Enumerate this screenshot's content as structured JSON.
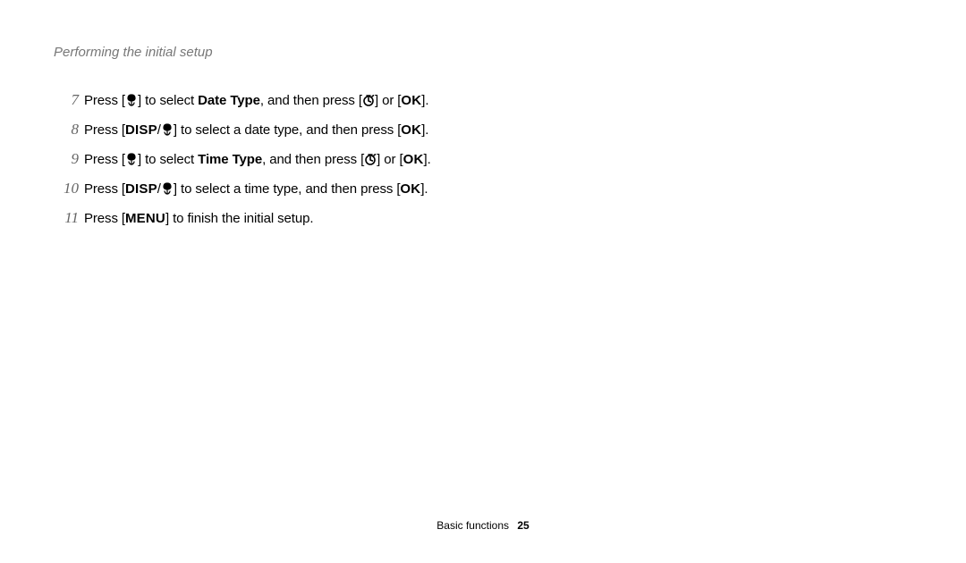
{
  "header_title": "Performing the initial setup",
  "icons": {
    "macro": "macro-icon",
    "timer": "timer-icon",
    "ok": "OK",
    "disp": "DISP",
    "menu": "MENU"
  },
  "steps": [
    {
      "num": "7",
      "pre": "Press [",
      "mid1": "] to select ",
      "bold": "Date Type",
      "mid2": ", and then press [",
      "mid3": "] or [",
      "tail": "].",
      "btn_left": "macro",
      "btn_mid": "timer",
      "btn_right": "ok",
      "disp_slash": false
    },
    {
      "num": "8",
      "pre": "Press [",
      "mid1": "] to select a date type, and then press [",
      "bold": "",
      "mid2": "",
      "mid3": "",
      "tail": "].",
      "btn_left": "dispmacro",
      "btn_mid": "",
      "btn_right": "ok",
      "disp_slash": true
    },
    {
      "num": "9",
      "pre": "Press [",
      "mid1": "] to select ",
      "bold": "Time Type",
      "mid2": ", and then press [",
      "mid3": "] or [",
      "tail": "].",
      "btn_left": "macro",
      "btn_mid": "timer",
      "btn_right": "ok",
      "disp_slash": false
    },
    {
      "num": "10",
      "pre": "Press [",
      "mid1": "] to select a time type, and then press [",
      "bold": "",
      "mid2": "",
      "mid3": "",
      "tail": "].",
      "btn_left": "dispmacro",
      "btn_mid": "",
      "btn_right": "ok",
      "disp_slash": true
    },
    {
      "num": "11",
      "pre": "Press [",
      "mid1": "] to finish the initial setup.",
      "bold": "",
      "mid2": "",
      "mid3": "",
      "tail": "",
      "btn_left": "menu",
      "btn_mid": "",
      "btn_right": "",
      "disp_slash": false
    }
  ],
  "footer": {
    "section": "Basic functions",
    "page": "25"
  }
}
